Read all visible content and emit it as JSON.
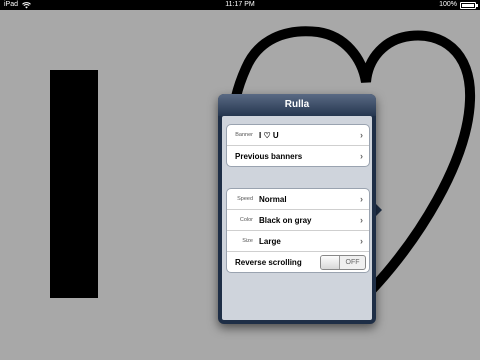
{
  "status_bar": {
    "device": "iPad",
    "time": "11:17 PM",
    "battery": "100%"
  },
  "banner": {
    "first_letter": "I"
  },
  "popover": {
    "title": "Rulla",
    "group1": [
      {
        "label": "Banner",
        "value": "I ♡ U"
      },
      {
        "label": "",
        "value": "Previous banners"
      }
    ],
    "group2": [
      {
        "label": "Speed",
        "value": "Normal"
      },
      {
        "label": "Color",
        "value": "Black on gray"
      },
      {
        "label": "Size",
        "value": "Large"
      },
      {
        "label": "",
        "value": "Reverse scrolling",
        "toggle": "OFF"
      }
    ]
  }
}
